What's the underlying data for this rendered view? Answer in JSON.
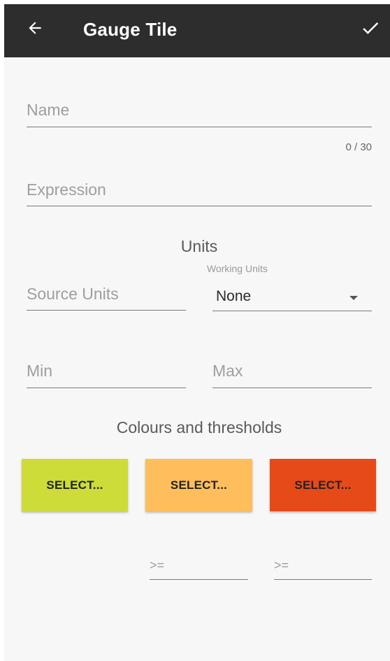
{
  "appbar": {
    "title": "Gauge Tile",
    "back_icon": "arrow-left-icon",
    "confirm_icon": "check-icon"
  },
  "form": {
    "name": {
      "placeholder": "Name",
      "value": "",
      "counter": "0 / 30"
    },
    "expression": {
      "placeholder": "Expression",
      "value": ""
    },
    "units_heading": "Units",
    "source_units": {
      "placeholder": "Source Units",
      "value": ""
    },
    "working_units": {
      "label": "Working Units",
      "selected": "None"
    },
    "min": {
      "placeholder": "Min",
      "value": ""
    },
    "max": {
      "placeholder": "Max",
      "value": ""
    },
    "colours_heading": "Colours and thresholds",
    "colour_buttons": [
      {
        "label": "SELECT...",
        "color": "#cddc39"
      },
      {
        "label": "SELECT...",
        "color": "#ffbe5c"
      },
      {
        "label": "SELECT...",
        "color": "#e64a19"
      }
    ],
    "thresholds": [
      {
        "placeholder": ">=",
        "value": ""
      },
      {
        "placeholder": ">=",
        "value": ""
      }
    ]
  },
  "colors": {
    "appbar_bg": "#2d2d2d",
    "background": "#f7f7f7"
  }
}
